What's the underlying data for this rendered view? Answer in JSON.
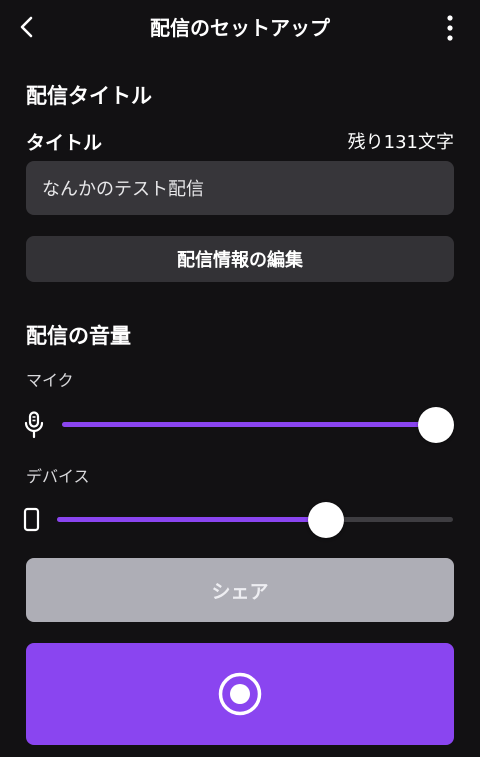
{
  "header": {
    "title": "配信のセットアップ",
    "back_icon": "chevron-left-icon",
    "more_icon": "more-vertical-icon"
  },
  "title_section": {
    "heading": "配信タイトル",
    "field_label": "タイトル",
    "remaining": "残り131文字",
    "input_value": "なんかのテスト配信",
    "edit_button": "配信情報の編集"
  },
  "volume_section": {
    "heading": "配信の音量",
    "mic": {
      "label": "マイク",
      "icon": "microphone-icon",
      "level": 1.0
    },
    "device": {
      "label": "デバイス",
      "icon": "smartphone-icon",
      "level": 0.68
    }
  },
  "actions": {
    "share_label": "シェア",
    "record_icon": "record-icon"
  },
  "colors": {
    "background": "#121113",
    "accent": "#8a45f0",
    "surface": "#37363a",
    "share_button": "#aeaeb6"
  }
}
